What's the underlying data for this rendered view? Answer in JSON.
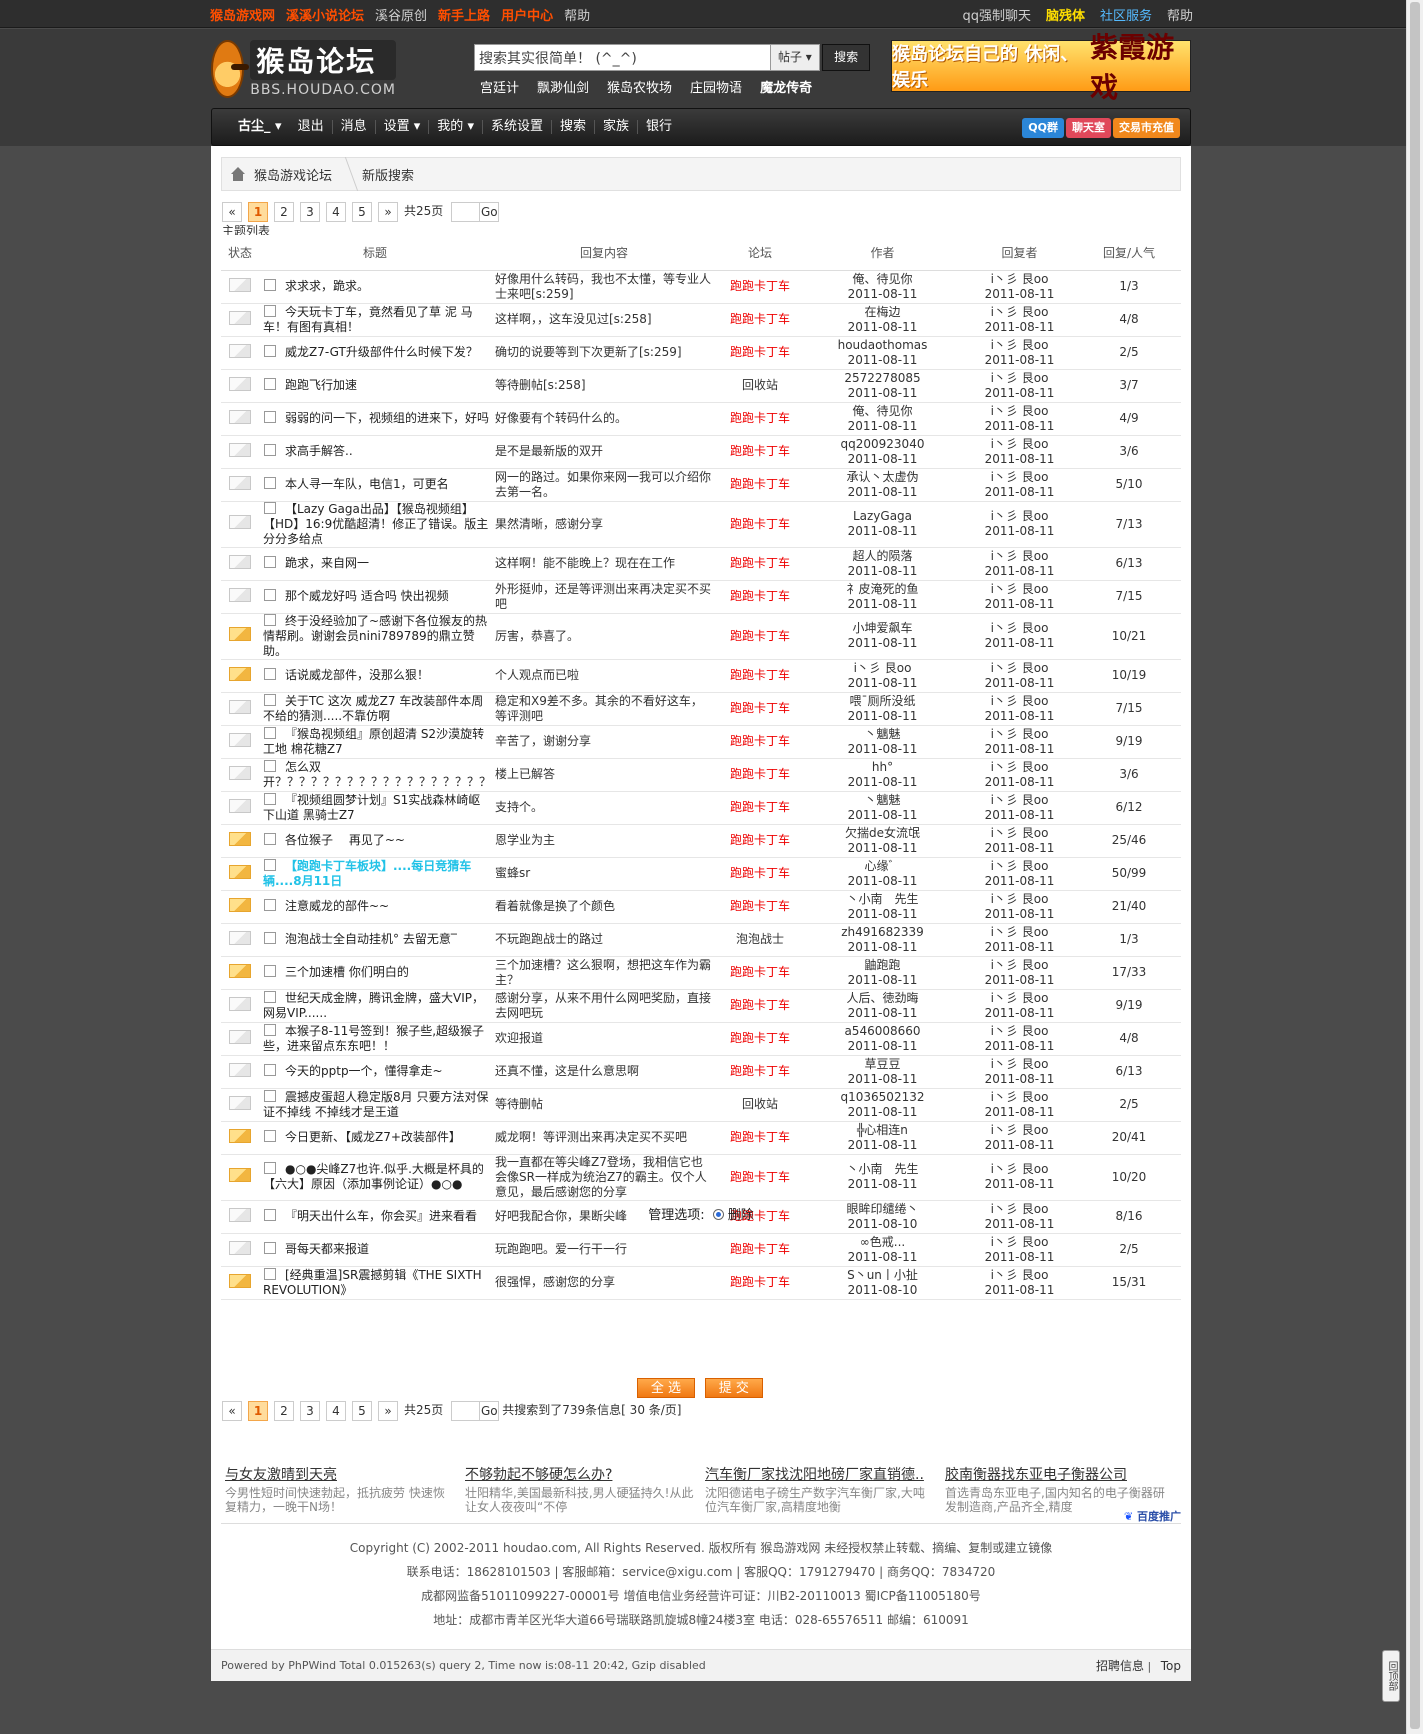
{
  "topbar": {
    "left_links": [
      {
        "label": "猴岛游戏网",
        "style": "hl"
      },
      {
        "label": "溪溪小说论坛",
        "style": "hl"
      },
      {
        "label": "溪谷原创",
        "style": "n"
      },
      {
        "label": "新手上路",
        "style": "hl"
      },
      {
        "label": "用户中心",
        "style": "hl"
      },
      {
        "label": "帮助",
        "style": "n"
      }
    ],
    "right_links": [
      {
        "label": "qq强制聊天",
        "style": "n"
      },
      {
        "label": "脑残体",
        "style": "y"
      },
      {
        "label": "社区服务",
        "style": "b"
      },
      {
        "label": "帮助",
        "style": "n"
      }
    ]
  },
  "header": {
    "logo_title": "猴岛论坛",
    "logo_sub": "BBS.HOUDAO.COM",
    "search_placeholder": "搜索其实很简单！ (^_^)",
    "search_type": "帖子",
    "search_button": "搜索",
    "hot_links": [
      {
        "label": "宫廷计",
        "bold": false
      },
      {
        "label": "飘渺仙剑",
        "bold": false
      },
      {
        "label": "猴岛农牧场",
        "bold": false
      },
      {
        "label": "庄园物语",
        "bold": false
      },
      {
        "label": "魔龙传奇",
        "bold": true
      }
    ],
    "banner_text1": "猴岛论坛自己的 休闲、娱乐",
    "banner_text2": "紫霞游戏"
  },
  "nav": {
    "items": [
      "古尘_",
      "退出",
      "消息",
      "设置",
      "我的",
      "系统设置",
      "搜索",
      "家族",
      "银行"
    ],
    "right_buttons": [
      "QQ群",
      "聊天室",
      "交易市充值"
    ]
  },
  "breadcrumb": {
    "home": "猴岛游戏论坛",
    "current": "新版搜索"
  },
  "pager": {
    "prev": "«",
    "next": "»",
    "pages": [
      "1",
      "2",
      "3",
      "4",
      "5"
    ],
    "current": "1",
    "total_pages": "共25页",
    "go": "Go"
  },
  "list_title": "主题列表",
  "columns": {
    "status": "状态",
    "title": "标题",
    "reply_content": "回复内容",
    "forum": "论坛",
    "author": "作者",
    "last_replier": "回复者",
    "counts": "回复/人气"
  },
  "rows": [
    {
      "hot": false,
      "title": "求求求，跪求。",
      "reply": "好像用什么转码，我也不太懂，等专业人士来吧[s:259]",
      "forum": "跑跑卡丁车",
      "author": "俺、待见你",
      "adate": "2011-08-11",
      "last": "i丶彡 艮oo",
      "ldate": "2011-08-11",
      "counts": "1/3"
    },
    {
      "hot": false,
      "title": "今天玩卡丁车，竟然看见了草 泥 马车！有图有真相！",
      "reply": "这样啊，，这车没见过[s:258]",
      "forum": "跑跑卡丁车",
      "author": "在梅边",
      "adate": "2011-08-11",
      "last": "i丶彡 艮oo",
      "ldate": "2011-08-11",
      "counts": "4/8"
    },
    {
      "hot": false,
      "title": "威龙Z7-GT升级部件什么时候下发？",
      "reply": "确切的说要等到下次更新了[s:259]",
      "forum": "跑跑卡丁车",
      "author": "houdaothomas",
      "adate": "2011-08-11",
      "last": "i丶彡 艮oo",
      "ldate": "2011-08-11",
      "counts": "2/5"
    },
    {
      "hot": false,
      "title": "跑跑飞行加速",
      "reply": "等待删帖[s:258]",
      "forum": "回收站",
      "author": "2572278085",
      "adate": "2011-08-11",
      "last": "i丶彡 艮oo",
      "ldate": "2011-08-11",
      "counts": "3/7"
    },
    {
      "hot": false,
      "title": "弱弱的问一下，视频组的进来下，好吗",
      "reply": "好像要有个转码什么的。",
      "forum": "跑跑卡丁车",
      "author": "俺、待见你",
      "adate": "2011-08-11",
      "last": "i丶彡 艮oo",
      "ldate": "2011-08-11",
      "counts": "4/9"
    },
    {
      "hot": false,
      "title": "求高手解答..",
      "reply": "是不是最新版的双开",
      "forum": "跑跑卡丁车",
      "author": "qq200923040",
      "adate": "2011-08-11",
      "last": "i丶彡 艮oo",
      "ldate": "2011-08-11",
      "counts": "3/6"
    },
    {
      "hot": false,
      "title": "本人寻一车队，电信1，可更名",
      "reply": "网一的路过。如果你来网一我可以介绍你去第一名。",
      "forum": "跑跑卡丁车",
      "author": "承认丶太虚伪",
      "adate": "2011-08-11",
      "last": "i丶彡 艮oo",
      "ldate": "2011-08-11",
      "counts": "5/10"
    },
    {
      "hot": false,
      "title": "【Lazy Gaga出品】【猴岛视频组】【HD】16:9优酷超清！修正了错误。版主分分多给点",
      "reply": "果然清晰，感谢分享",
      "forum": "跑跑卡丁车",
      "author": "LazyGaga",
      "adate": "2011-08-11",
      "last": "i丶彡 艮oo",
      "ldate": "2011-08-11",
      "counts": "7/13"
    },
    {
      "hot": false,
      "title": "跪求，来自网一",
      "reply": "这样啊！能不能晚上？现在在工作",
      "forum": "跑跑卡丁车",
      "author": "超人的陨落",
      "adate": "2011-08-11",
      "last": "i丶彡 艮oo",
      "ldate": "2011-08-11",
      "counts": "6/13"
    },
    {
      "hot": false,
      "title": "那个威龙好吗 适合吗 快出视频",
      "reply": "外形挺帅，还是等评测出来再决定买不买吧",
      "forum": "跑跑卡丁车",
      "author": "礻皮淹死的鱼",
      "adate": "2011-08-11",
      "last": "i丶彡 艮oo",
      "ldate": "2011-08-11",
      "counts": "7/15"
    },
    {
      "hot": true,
      "title": "终于没经验加了~感谢下各位猴友的热情帮刷。谢谢会员nini789789的鼎立赞助。",
      "reply": "厉害，恭喜了。",
      "forum": "跑跑卡丁车",
      "author": "小坤爱飙车",
      "adate": "2011-08-11",
      "last": "i丶彡 艮oo",
      "ldate": "2011-08-11",
      "counts": "10/21"
    },
    {
      "hot": true,
      "title": "话说威龙部件，没那么狠！",
      "reply": "个人观点而已啦",
      "forum": "跑跑卡丁车",
      "author": "i丶彡 艮oo",
      "adate": "2011-08-11",
      "last": "i丶彡 艮oo",
      "ldate": "2011-08-11",
      "counts": "10/19"
    },
    {
      "hot": false,
      "title": "关于TC 这次 威龙Z7 车改装部件本周不给的猜测.....不靠仿啊",
      "reply": "稳定和X9差不多。其余的不看好这车，等评测吧",
      "forum": "跑跑卡丁车",
      "author": "喂ˉ厕所没纸",
      "adate": "2011-08-11",
      "last": "i丶彡 艮oo",
      "ldate": "2011-08-11",
      "counts": "7/15"
    },
    {
      "hot": false,
      "title": "『猴岛视频组』原创超清 S2沙漠旋转工地 棉花糖Z7",
      "reply": "辛苦了，谢谢分享",
      "forum": "跑跑卡丁车",
      "author": "丶魑魅",
      "adate": "2011-08-11",
      "last": "i丶彡 艮oo",
      "ldate": "2011-08-11",
      "counts": "9/19"
    },
    {
      "hot": false,
      "title": "怎么双开？？？？？？？？？？？？？？？？？？？",
      "reply": "楼上已解答",
      "forum": "跑跑卡丁车",
      "author": "hh°",
      "adate": "2011-08-11",
      "last": "i丶彡 艮oo",
      "ldate": "2011-08-11",
      "counts": "3/6"
    },
    {
      "hot": false,
      "title": "『视频组圆梦计划』S1实战森林崎岖下山道 黑骑士Z7",
      "reply": "支持个。",
      "forum": "跑跑卡丁车",
      "author": "丶魑魅",
      "adate": "2011-08-11",
      "last": "i丶彡 艮oo",
      "ldate": "2011-08-11",
      "counts": "6/12"
    },
    {
      "hot": true,
      "title": "各位猴子　 再见了~~",
      "reply": "恩学业为主",
      "forum": "跑跑卡丁车",
      "author": "欠揣de女流氓",
      "adate": "2011-08-11",
      "last": "i丶彡 艮oo",
      "ldate": "2011-08-11",
      "counts": "25/46"
    },
    {
      "hot": true,
      "cyan": true,
      "title": "【跑跑卡丁车板块】....每日竞猜车辆....8月11日",
      "reply": "蜜蜂sr",
      "forum": "跑跑卡丁车",
      "author": "心缘゛",
      "adate": "2011-08-11",
      "last": "i丶彡 艮oo",
      "ldate": "2011-08-11",
      "counts": "50/99"
    },
    {
      "hot": true,
      "title": "注意威龙的部件~~",
      "reply": "看着就像是换了个颜色",
      "forum": "跑跑卡丁车",
      "author": "丶小南　先生",
      "adate": "2011-08-11",
      "last": "i丶彡 艮oo",
      "ldate": "2011-08-11",
      "counts": "21/40"
    },
    {
      "hot": false,
      "title": "泡泡战士全自动挂机° 去留无意‾",
      "reply": "不玩跑跑战士的路过",
      "forum": "泡泡战士",
      "author": "zh491682339",
      "adate": "2011-08-11",
      "last": "i丶彡 艮oo",
      "ldate": "2011-08-11",
      "counts": "1/3"
    },
    {
      "hot": true,
      "title": "三个加速槽 你们明白的",
      "reply": "三个加速槽？这么狠啊，想把这车作为霸主？",
      "forum": "跑跑卡丁车",
      "author": "鼬跑跑",
      "adate": "2011-08-11",
      "last": "i丶彡 艮oo",
      "ldate": "2011-08-11",
      "counts": "17/33"
    },
    {
      "hot": false,
      "title": "世纪天成金牌，腾讯金牌，盛大VIP，网易VIP......",
      "reply": "感谢分享，从来不用什么网吧奖励，直接去网吧玩",
      "forum": "跑跑卡丁车",
      "author": "人后、徳劲晦",
      "adate": "2011-08-11",
      "last": "i丶彡 艮oo",
      "ldate": "2011-08-11",
      "counts": "9/19"
    },
    {
      "hot": false,
      "title": "本猴子8-11号签到！猴子些,超级猴子些，进来留点东东吧！！",
      "reply": "欢迎报道",
      "forum": "跑跑卡丁车",
      "author": "a546008660",
      "adate": "2011-08-11",
      "last": "i丶彡 艮oo",
      "ldate": "2011-08-11",
      "counts": "4/8"
    },
    {
      "hot": false,
      "title": "今天的pptp一个，懂得拿走~",
      "reply": "还真不懂，这是什么意思啊",
      "forum": "跑跑卡丁车",
      "author": "草豆豆",
      "adate": "2011-08-11",
      "last": "i丶彡 艮oo",
      "ldate": "2011-08-11",
      "counts": "6/13"
    },
    {
      "hot": false,
      "title": "震撼皮蛋超人稳定版8月 只要方法对保证不掉线 不掉线才是王道",
      "reply": "等待删帖",
      "forum": "回收站",
      "author": "q1036502132",
      "adate": "2011-08-11",
      "last": "i丶彡 艮oo",
      "ldate": "2011-08-11",
      "counts": "2/5"
    },
    {
      "hot": true,
      "title": "今日更新、【威龙Z7+改装部件】",
      "reply": "威龙啊！等评测出来再决定买不买吧",
      "forum": "跑跑卡丁车",
      "author": "╬心相连n",
      "adate": "2011-08-11",
      "last": "i丶彡 艮oo",
      "ldate": "2011-08-11",
      "counts": "20/41"
    },
    {
      "hot": true,
      "tall": true,
      "title": "●○●尖峰Z7也许.似乎.大概是杯具的【六大】原因（添加事例论证）●○●",
      "reply": "我一直都在等尖峰Z7登场，我相信它也会像SR一样成为统治Z7的霸主。仅个人意见，最后感谢您的分享",
      "forum": "跑跑卡丁车",
      "author": "丶小南　先生",
      "adate": "2011-08-11",
      "last": "i丶彡 艮oo",
      "ldate": "2011-08-11",
      "counts": "10/20"
    },
    {
      "hot": false,
      "title": "『明天出什么车，你会买』进来看看",
      "reply": "好吧我配合你，果断尖峰",
      "forum": "跑跑卡丁车",
      "author": "眼眸印缱绻丶",
      "adate": "2011-08-10",
      "last": "i丶彡 艮oo",
      "ldate": "2011-08-11",
      "counts": "8/16"
    },
    {
      "hot": false,
      "title": "哥每天都来报道",
      "reply": "玩跑跑吧。爱一行干一行",
      "forum": "跑跑卡丁车",
      "author": "∞色戒...",
      "adate": "2011-08-11",
      "last": "i丶彡 艮oo",
      "ldate": "2011-08-11",
      "counts": "2/5"
    },
    {
      "hot": true,
      "title": "[经典重温]SR震撼剪辑《THE SIXTH REVOLUTION》",
      "reply": "很强悍，感谢您的分享",
      "forum": "跑跑卡丁车",
      "author": "S丶un丨小扯",
      "adate": "2011-08-10",
      "last": "i丶彡 艮oo",
      "ldate": "2011-08-11",
      "counts": "15/31"
    }
  ],
  "admin": {
    "label": "管理选项:",
    "option": "删除"
  },
  "buttons": {
    "select_all": "全 选",
    "submit": "提 交"
  },
  "search_info": "共搜索到了739条信息[ 30 条/页]",
  "ads": [
    {
      "title": "与女友激晴到天亮",
      "desc": "今男性短时间快速勃起，抵抗疲劳 快速恢复精力，一晚干N场！"
    },
    {
      "title": "不够勃起不够硬怎么办?",
      "desc": "壮阳精华,美国最新科技,男人硬猛持久!从此让女人夜夜叫“不停"
    },
    {
      "title": "汽车衡厂家找沈阳地磅厂家直销德..",
      "desc": "沈阳德诺电子磅生产数字汽车衡厂家,大吨位汽车衡厂家,高精度地衡"
    },
    {
      "title": "胶南衡器找东亚电子衡器公司",
      "desc": "首选青岛东亚电子,国内知名的电子衡器研发制造商,产品齐全,精度"
    }
  ],
  "baidu": "百度推广",
  "footer": {
    "lines": [
      "Copyright (C) 2002-2011 houdao.com, All Rights Reserved. 版权所有 猴岛游戏网 未经授权禁止转载、摘编、复制或建立镜像",
      "联系电话：18628101503 | 客服邮箱：service@xigu.com | 客服QQ：1791279470 | 商务QQ：7834720",
      "成都网监备51011099227-00001号 增值电信业务经营许可证：川B2-20110013 蜀ICP备11005180号",
      "地址：成都市青羊区光华大道66号瑞联路凯旋城8幢24楼3室 电话：028-65576511 邮编：610091"
    ],
    "powered": "Powered by PhPWind Total 0.015263(s) query 2, Time now is:08-11 20:42, Gzip disabled",
    "jobs": "招聘信息",
    "top": "Top"
  },
  "totop": "回顶部"
}
